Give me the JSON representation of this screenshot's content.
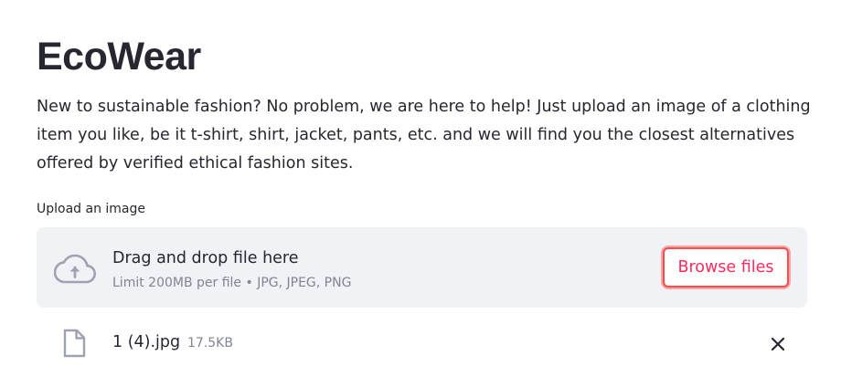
{
  "app": {
    "title": "EcoWear",
    "description": "New to sustainable fashion? No problem, we are here to help! Just upload an image of a clothing item you like, be it t-shirt, shirt, jacket, pants, etc. and we will find you the closest alternatives offered by verified ethical fashion sites."
  },
  "uploader": {
    "label": "Upload an image",
    "dropzone": {
      "icon": "cloud-upload-icon",
      "title": "Drag and drop file here",
      "limit": "Limit 200MB per file • JPG, JPEG, PNG",
      "browse_label": "Browse files"
    },
    "file": {
      "icon": "file-icon",
      "name": "1 (4).jpg",
      "size": "17.5KB",
      "remove_icon": "close-icon"
    }
  },
  "colors": {
    "text": "#262730",
    "muted": "#808495",
    "dropzone_bg": "#f0f2f6",
    "accent": "#ff4b4b"
  }
}
